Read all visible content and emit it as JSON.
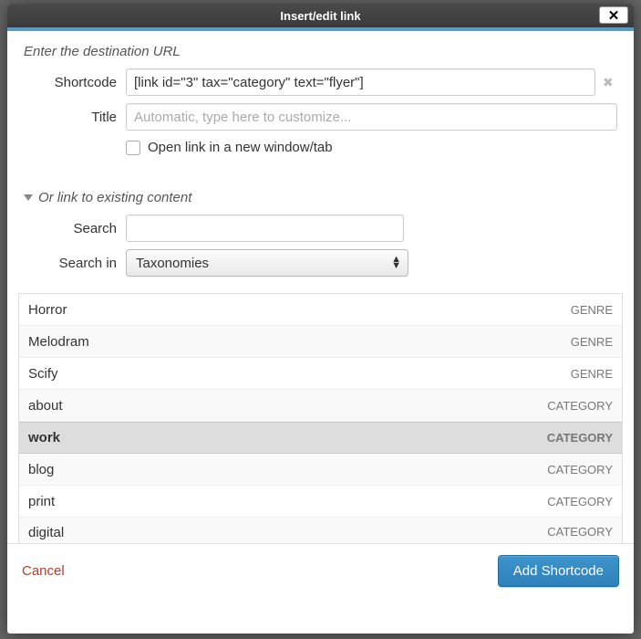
{
  "dialog": {
    "title": "Insert/edit link",
    "section1_heading": "Enter the destination URL",
    "shortcode_label": "Shortcode",
    "shortcode_value": "[link id=\"3\" tax=\"category\" text=\"flyer\"]",
    "title_label": "Title",
    "title_placeholder": "Automatic, type here to customize...",
    "newtab_label": "Open link in a new window/tab",
    "section2_heading": "Or link to existing content",
    "search_label": "Search",
    "searchin_label": "Search in",
    "searchin_selected": "Taxonomies",
    "results": [
      {
        "name": "Horror",
        "type": "GENRE",
        "selected": false
      },
      {
        "name": "Melodram",
        "type": "GENRE",
        "selected": false
      },
      {
        "name": "Scify",
        "type": "GENRE",
        "selected": false
      },
      {
        "name": "about",
        "type": "CATEGORY",
        "selected": false
      },
      {
        "name": "work",
        "type": "CATEGORY",
        "selected": true
      },
      {
        "name": "blog",
        "type": "CATEGORY",
        "selected": false
      },
      {
        "name": "print",
        "type": "CATEGORY",
        "selected": false
      },
      {
        "name": "digital",
        "type": "CATEGORY",
        "selected": false
      }
    ],
    "cancel_label": "Cancel",
    "submit_label": "Add Shortcode"
  }
}
